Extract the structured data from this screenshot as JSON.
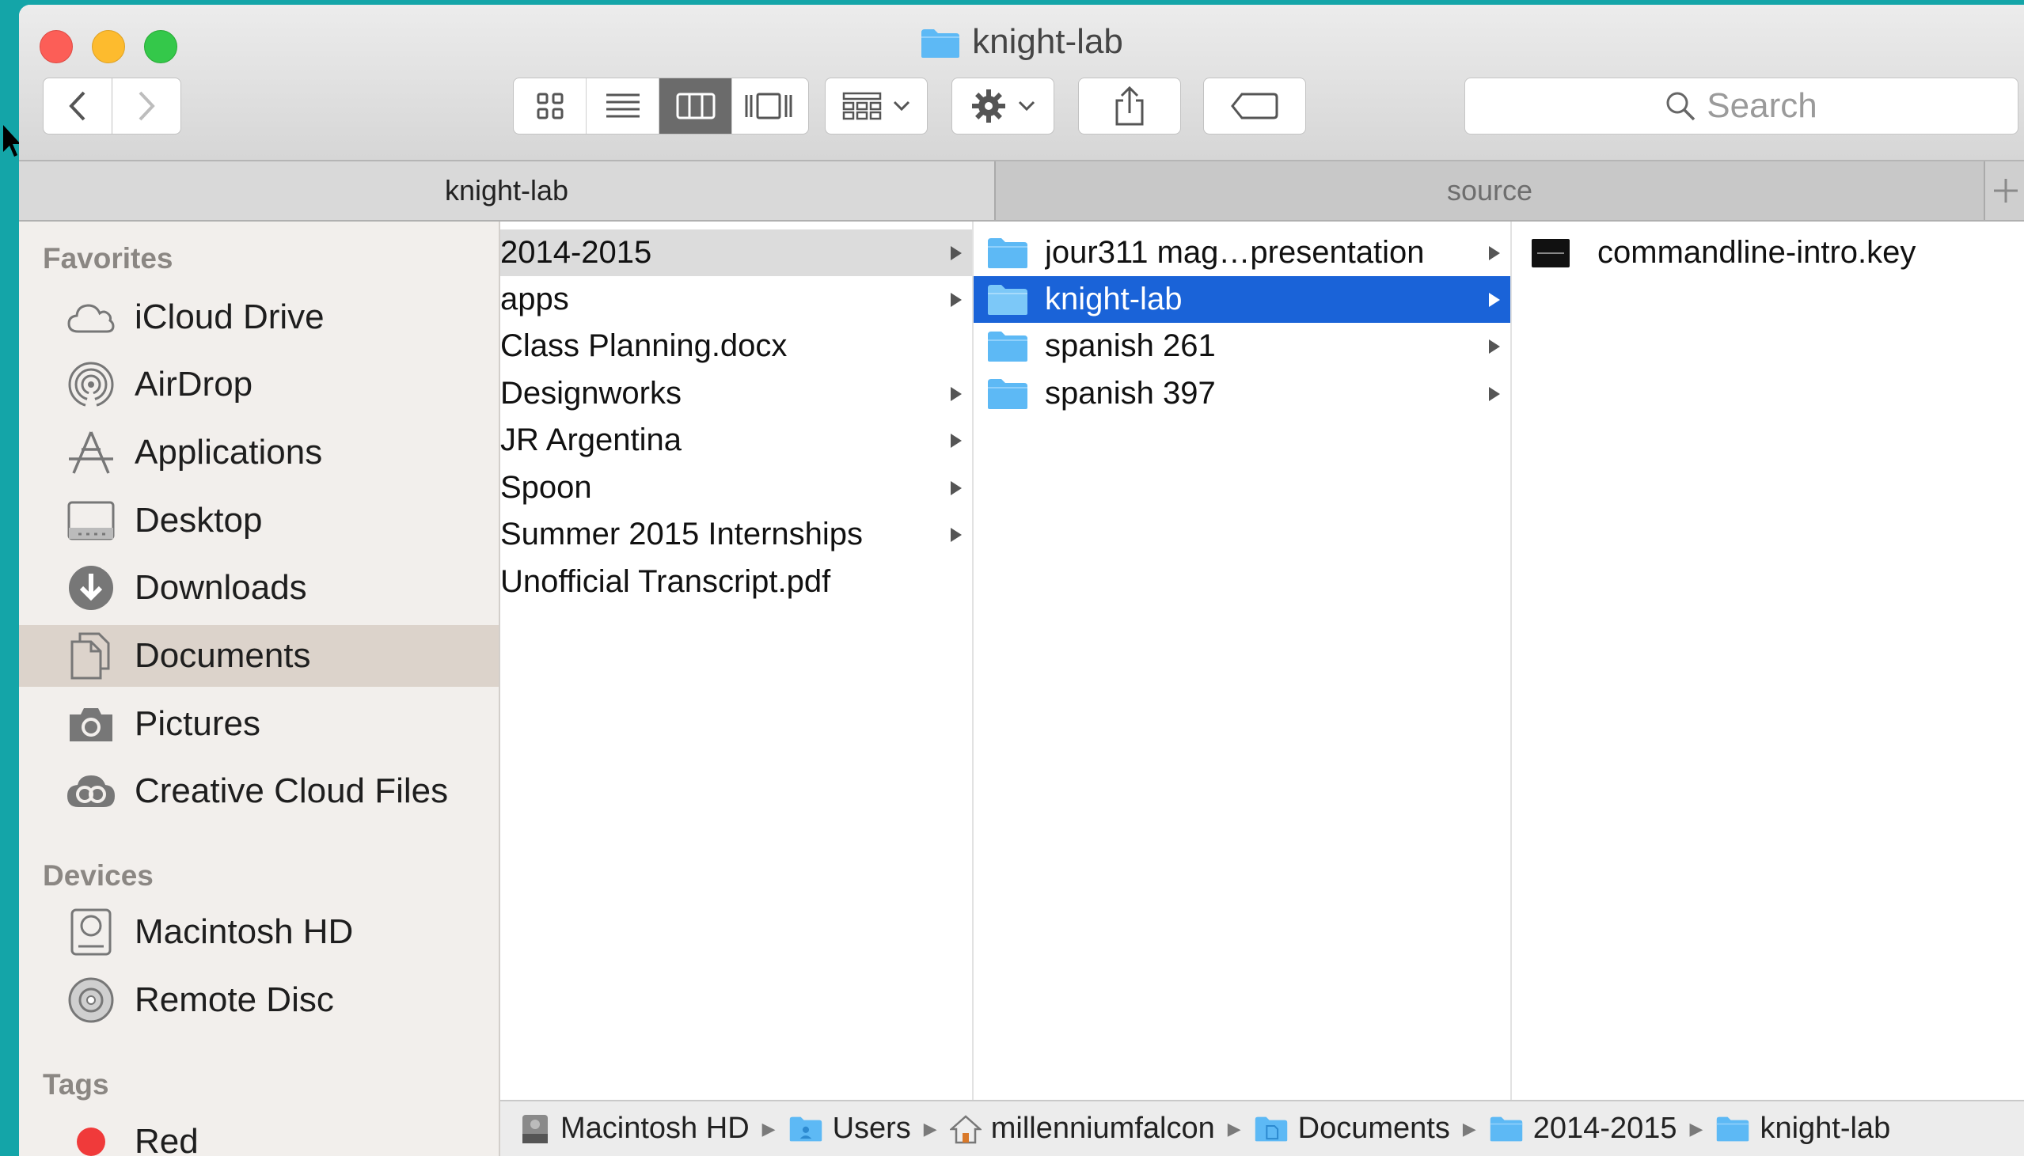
{
  "window": {
    "title": "knight-lab"
  },
  "search": {
    "placeholder": "Search"
  },
  "tabs": [
    {
      "label": "knight-lab",
      "active": true
    },
    {
      "label": "source",
      "active": false
    }
  ],
  "sidebar": {
    "favorites_heading": "Favorites",
    "favorites": [
      {
        "label": "iCloud Drive",
        "icon": "cloud-icon"
      },
      {
        "label": "AirDrop",
        "icon": "airdrop-icon"
      },
      {
        "label": "Applications",
        "icon": "applications-icon"
      },
      {
        "label": "Desktop",
        "icon": "desktop-icon"
      },
      {
        "label": "Downloads",
        "icon": "downloads-icon"
      },
      {
        "label": "Documents",
        "icon": "documents-icon",
        "selected": true
      },
      {
        "label": "Pictures",
        "icon": "camera-icon"
      },
      {
        "label": "Creative Cloud Files",
        "icon": "creative-cloud-icon"
      }
    ],
    "devices_heading": "Devices",
    "devices": [
      {
        "label": "Macintosh HD",
        "icon": "hard-drive-icon"
      },
      {
        "label": "Remote Disc",
        "icon": "disc-icon"
      }
    ],
    "tags_heading": "Tags",
    "tags": [
      {
        "label": "Red",
        "color": "#f03a3a"
      }
    ]
  },
  "column1": [
    {
      "name": "2014-2015",
      "folder": true,
      "selected": true
    },
    {
      "name": "apps",
      "folder": true
    },
    {
      "name": "Class Planning.docx",
      "folder": false
    },
    {
      "name": "Designworks",
      "folder": true
    },
    {
      "name": "JR Argentina",
      "folder": true
    },
    {
      "name": "Spoon",
      "folder": true
    },
    {
      "name": "Summer 2015 Internships",
      "folder": true
    },
    {
      "name": "Unofficial Transcript.pdf",
      "folder": false
    }
  ],
  "column2": [
    {
      "name": "jour311 mag…presentation",
      "folder": true
    },
    {
      "name": "knight-lab",
      "folder": true,
      "selected": true
    },
    {
      "name": "spanish 261",
      "folder": true
    },
    {
      "name": "spanish 397",
      "folder": true
    }
  ],
  "column3": [
    {
      "name": "commandline-intro.key",
      "folder": false,
      "icon": "keynote-file-icon"
    }
  ],
  "pathbar": [
    {
      "label": "Macintosh HD",
      "icon": "hard-drive-icon"
    },
    {
      "label": "Users",
      "icon": "folder-icon"
    },
    {
      "label": "millenniumfalcon",
      "icon": "home-icon"
    },
    {
      "label": "Documents",
      "icon": "folder-icon"
    },
    {
      "label": "2014-2015",
      "icon": "folder-icon"
    },
    {
      "label": "knight-lab",
      "icon": "folder-icon"
    }
  ],
  "colors": {
    "selection_blue": "#1a63d8",
    "folder_blue": "#5db9f5",
    "desktop_bg": "#14a5a8"
  }
}
